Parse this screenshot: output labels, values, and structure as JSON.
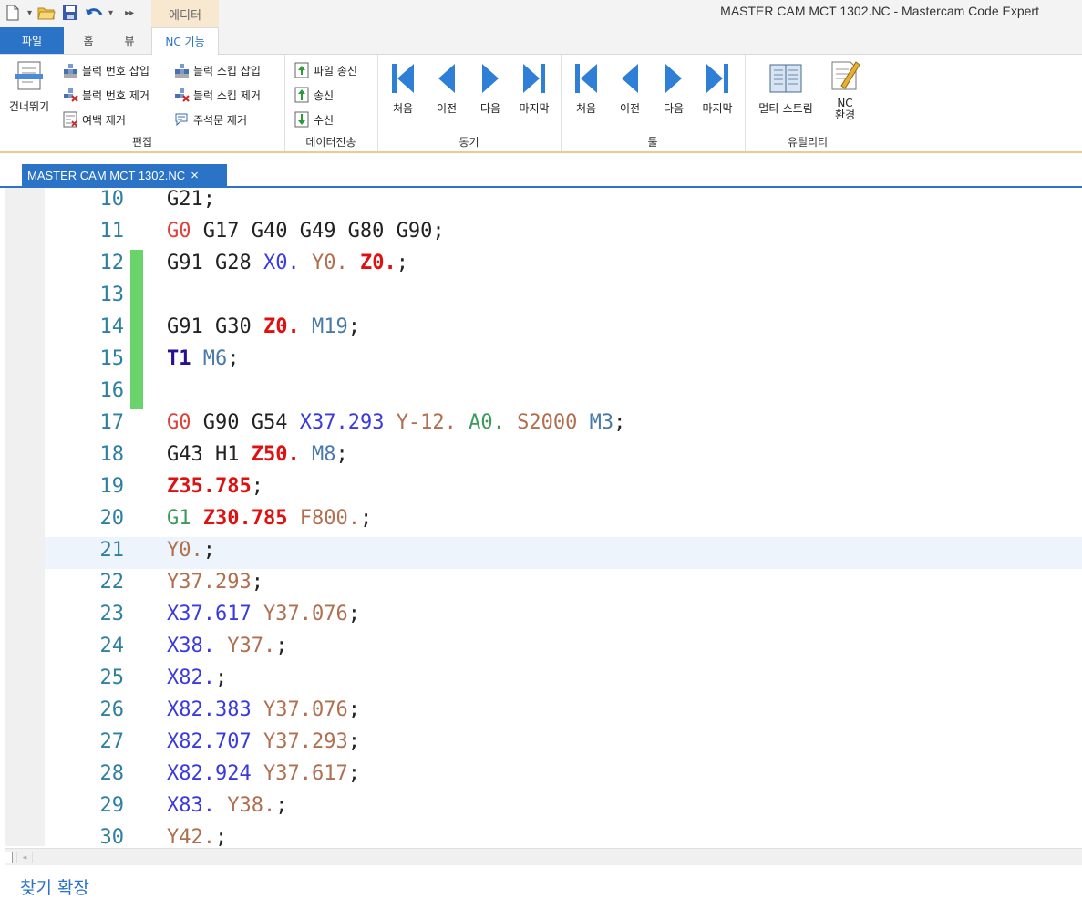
{
  "window": {
    "title": "MASTER CAM MCT 1302.NC - Mastercam Code Expert",
    "context_tab": "에디터"
  },
  "quick_access": [
    {
      "name": "new-file-icon"
    },
    {
      "name": "open-folder-icon"
    },
    {
      "name": "save-icon"
    },
    {
      "name": "undo-icon"
    }
  ],
  "ribbon_tabs": {
    "file": "파일",
    "home": "홈",
    "view": "뷰",
    "nc": "NC 기능"
  },
  "ribbon": {
    "edit_group": {
      "label": "편집",
      "skip": "건너뛰기",
      "insert_block_number": "블럭 번호 삽입",
      "remove_block_number": "블럭 번호 제거",
      "remove_spaces": "여백 제거",
      "insert_block_skip": "블럭 스킵 삽입",
      "remove_block_skip": "블럭 스킵 제거",
      "remove_comments": "주석문 제거"
    },
    "transfer_group": {
      "label": "데이터전송",
      "send_file": "파일 송신",
      "send": "송신",
      "receive": "수신"
    },
    "sync_group": {
      "label": "동기",
      "first": "처음",
      "prev": "이전",
      "next": "다음",
      "last": "마지막"
    },
    "tool_group": {
      "label": "툴",
      "first": "처음",
      "prev": "이전",
      "next": "다음",
      "last": "마지막"
    },
    "utility_group": {
      "label": "유틸리티",
      "multi_stream": "멀티-스트림",
      "nc_env_line1": "NC",
      "nc_env_line2": "환경"
    }
  },
  "document_tab": {
    "label": "MASTER CAM MCT 1302.NC",
    "close": "×"
  },
  "editor": {
    "current_line": 21,
    "lines": [
      {
        "n": "10",
        "mark": false,
        "tokens": [
          {
            "t": "G21",
            "c": "plain"
          },
          {
            "t": ";",
            "c": "punc"
          }
        ]
      },
      {
        "n": "11",
        "mark": false,
        "tokens": [
          {
            "t": "G0",
            "c": "red"
          },
          {
            "t": " G17 G40 G49 G80 G90",
            "c": "plain"
          },
          {
            "t": ";",
            "c": "punc"
          }
        ]
      },
      {
        "n": "12",
        "mark": true,
        "tokens": [
          {
            "t": "G91 G28 ",
            "c": "plain"
          },
          {
            "t": "X0.",
            "c": "blue"
          },
          {
            "t": " ",
            "c": "plain"
          },
          {
            "t": "Y0.",
            "c": "brown"
          },
          {
            "t": " ",
            "c": "plain"
          },
          {
            "t": "Z0.",
            "c": "redb"
          },
          {
            "t": ";",
            "c": "punc"
          }
        ]
      },
      {
        "n": "13",
        "mark": true,
        "tokens": []
      },
      {
        "n": "14",
        "mark": true,
        "tokens": [
          {
            "t": "G91 G30 ",
            "c": "plain"
          },
          {
            "t": "Z0.",
            "c": "redb"
          },
          {
            "t": " ",
            "c": "plain"
          },
          {
            "t": "M19",
            "c": "teal"
          },
          {
            "t": ";",
            "c": "punc"
          }
        ]
      },
      {
        "n": "15",
        "mark": true,
        "tokens": [
          {
            "t": "T1",
            "c": "tbold"
          },
          {
            "t": " ",
            "c": "plain"
          },
          {
            "t": "M6",
            "c": "teal"
          },
          {
            "t": ";",
            "c": "punc"
          }
        ]
      },
      {
        "n": "16",
        "mark": true,
        "tokens": []
      },
      {
        "n": "17",
        "mark": false,
        "tokens": [
          {
            "t": "G0",
            "c": "red"
          },
          {
            "t": " G90 G54 ",
            "c": "plain"
          },
          {
            "t": "X37.293",
            "c": "blue"
          },
          {
            "t": " ",
            "c": "plain"
          },
          {
            "t": "Y-12.",
            "c": "brown"
          },
          {
            "t": " ",
            "c": "plain"
          },
          {
            "t": "A0.",
            "c": "green"
          },
          {
            "t": " ",
            "c": "plain"
          },
          {
            "t": "S2000",
            "c": "brown"
          },
          {
            "t": " ",
            "c": "plain"
          },
          {
            "t": "M3",
            "c": "teal"
          },
          {
            "t": ";",
            "c": "punc"
          }
        ]
      },
      {
        "n": "18",
        "mark": false,
        "tokens": [
          {
            "t": "G43 H1 ",
            "c": "plain"
          },
          {
            "t": "Z50.",
            "c": "redb"
          },
          {
            "t": " ",
            "c": "plain"
          },
          {
            "t": "M8",
            "c": "teal"
          },
          {
            "t": ";",
            "c": "punc"
          }
        ]
      },
      {
        "n": "19",
        "mark": false,
        "tokens": [
          {
            "t": "Z35.785",
            "c": "redb"
          },
          {
            "t": ";",
            "c": "punc"
          }
        ]
      },
      {
        "n": "20",
        "mark": false,
        "tokens": [
          {
            "t": "G1",
            "c": "green"
          },
          {
            "t": " ",
            "c": "plain"
          },
          {
            "t": "Z30.785",
            "c": "redb"
          },
          {
            "t": " ",
            "c": "plain"
          },
          {
            "t": "F800.",
            "c": "brown"
          },
          {
            "t": ";",
            "c": "punc"
          }
        ]
      },
      {
        "n": "21",
        "mark": false,
        "tokens": [
          {
            "t": "Y0.",
            "c": "brown"
          },
          {
            "t": ";",
            "c": "punc"
          }
        ]
      },
      {
        "n": "22",
        "mark": false,
        "tokens": [
          {
            "t": "Y37.293",
            "c": "brown"
          },
          {
            "t": ";",
            "c": "punc"
          }
        ]
      },
      {
        "n": "23",
        "mark": false,
        "tokens": [
          {
            "t": "X37.617",
            "c": "blue"
          },
          {
            "t": " ",
            "c": "plain"
          },
          {
            "t": "Y37.076",
            "c": "brown"
          },
          {
            "t": ";",
            "c": "punc"
          }
        ]
      },
      {
        "n": "24",
        "mark": false,
        "tokens": [
          {
            "t": "X38.",
            "c": "blue"
          },
          {
            "t": " ",
            "c": "plain"
          },
          {
            "t": "Y37.",
            "c": "brown"
          },
          {
            "t": ";",
            "c": "punc"
          }
        ]
      },
      {
        "n": "25",
        "mark": false,
        "tokens": [
          {
            "t": "X82.",
            "c": "blue"
          },
          {
            "t": ";",
            "c": "punc"
          }
        ]
      },
      {
        "n": "26",
        "mark": false,
        "tokens": [
          {
            "t": "X82.383",
            "c": "blue"
          },
          {
            "t": " ",
            "c": "plain"
          },
          {
            "t": "Y37.076",
            "c": "brown"
          },
          {
            "t": ";",
            "c": "punc"
          }
        ]
      },
      {
        "n": "27",
        "mark": false,
        "tokens": [
          {
            "t": "X82.707",
            "c": "blue"
          },
          {
            "t": " ",
            "c": "plain"
          },
          {
            "t": "Y37.293",
            "c": "brown"
          },
          {
            "t": ";",
            "c": "punc"
          }
        ]
      },
      {
        "n": "28",
        "mark": false,
        "tokens": [
          {
            "t": "X82.924",
            "c": "blue"
          },
          {
            "t": " ",
            "c": "plain"
          },
          {
            "t": "Y37.617",
            "c": "brown"
          },
          {
            "t": ";",
            "c": "punc"
          }
        ]
      },
      {
        "n": "29",
        "mark": false,
        "tokens": [
          {
            "t": "X83.",
            "c": "blue"
          },
          {
            "t": " ",
            "c": "plain"
          },
          {
            "t": "Y38.",
            "c": "brown"
          },
          {
            "t": ";",
            "c": "punc"
          }
        ]
      },
      {
        "n": "30",
        "mark": false,
        "tokens": [
          {
            "t": "Y42.",
            "c": "brown"
          },
          {
            "t": ";",
            "c": "punc"
          }
        ]
      }
    ]
  },
  "findbar": {
    "label": "찾기 확장"
  },
  "colors": {
    "accent": "#2b73c6",
    "change_marker": "#6ad46a",
    "current_line": "#eef4fc"
  }
}
